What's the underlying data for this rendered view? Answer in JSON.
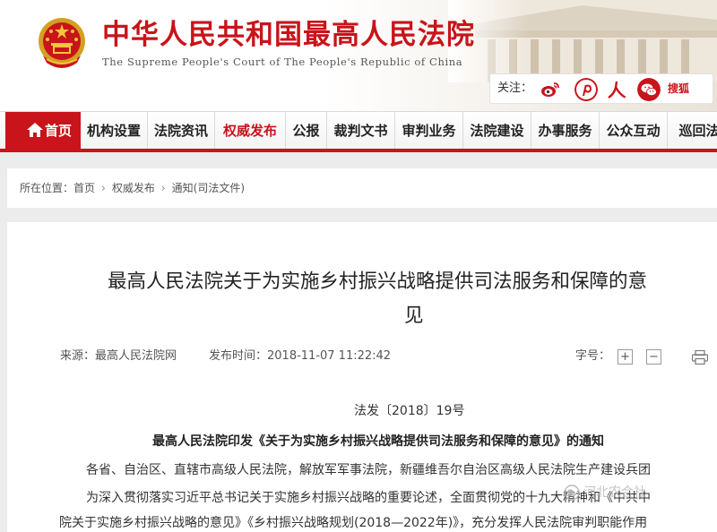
{
  "header": {
    "title": "中华人民共和国最高人民法院",
    "subtitle": "The Supreme People's Court of The People's Republic of China",
    "follow_label": "关注：",
    "social_icons": [
      "weibo-icon",
      "pinterest-style-icon",
      "people-icon",
      "wechat-icon"
    ],
    "sohu_label": "搜狐"
  },
  "nav": {
    "items": [
      {
        "label": "首页",
        "icon": "home-icon",
        "active": true
      },
      {
        "label": "机构设置"
      },
      {
        "label": "法院资讯"
      },
      {
        "label": "权威发布",
        "accent": true
      },
      {
        "label": "公报"
      },
      {
        "label": "裁判文书"
      },
      {
        "label": "审判业务"
      },
      {
        "label": "法院建设"
      },
      {
        "label": "办事服务"
      },
      {
        "label": "公众互动"
      },
      {
        "label": "巡回法"
      }
    ]
  },
  "breadcrumb": {
    "prefix": "所在位置：",
    "items": [
      "首页",
      "权威发布",
      "通知(司法文件)"
    ],
    "separator": "›"
  },
  "article": {
    "title_line1": "最高人民法院关于为实施乡村振兴战略提供司法服务和保障的意",
    "title_line2": "见",
    "source": "来源：最高人民法院网",
    "publish_time": "发布时间：2018-11-07 11:22:42",
    "font_size_label": "字号：",
    "font_increase": "+",
    "font_decrease": "−",
    "doc_number": "法发〔2018〕19号",
    "subtitle": "最高人民法院印发《关于为实施乡村振兴战略提供司法服务和保障的意见》的通知",
    "paragraphs": [
      "各省、自治区、直辖市高级人民法院，解放军军事法院，新疆维吾尔自治区高级人民法院生产建设兵团",
      "为深入贯彻落实习近平总书记关于实施乡村振兴战略的重要论述，全面贯彻党的十九大精神和《中共中",
      "院关于实施乡村振兴战略的意见》《乡村振兴战略规划(2018—2022年)》，充分发挥人民法院审判职能作用"
    ],
    "watermark": "河北农合社"
  },
  "colors": {
    "brand_red": "#c8141a",
    "page_bg": "#ececec"
  }
}
